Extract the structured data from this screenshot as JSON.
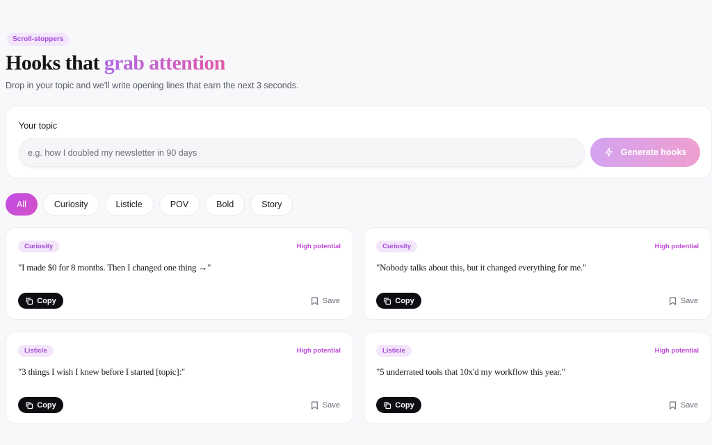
{
  "header": {
    "eyebrow": "Scroll-stoppers",
    "title_plain": "Hooks that",
    "title_accent": "grab attention",
    "subtitle": "Drop in your topic and we'll write opening lines that earn the next 3 seconds."
  },
  "topic": {
    "label": "Your topic",
    "placeholder": "e.g. how I doubled my newsletter in 90 days",
    "value": "",
    "generate_label": "Generate hooks",
    "generate_icon": "bolt-icon"
  },
  "filters": [
    {
      "label": "All",
      "active": true
    },
    {
      "label": "Curiosity",
      "active": false
    },
    {
      "label": "Listicle",
      "active": false
    },
    {
      "label": "POV",
      "active": false
    },
    {
      "label": "Bold",
      "active": false
    },
    {
      "label": "Story",
      "active": false
    }
  ],
  "hooks": [
    {
      "tag": "Curiosity",
      "potential": "High potential",
      "text": "\"I made $0 for 8 months. Then I changed one thing →\"",
      "copy_label": "Copy",
      "save_label": "Save"
    },
    {
      "tag": "Curiosity",
      "potential": "High potential",
      "text": "\"Nobody talks about this, but it changed everything for me.\"",
      "copy_label": "Copy",
      "save_label": "Save"
    },
    {
      "tag": "Listicle",
      "potential": "High potential",
      "text": "\"3 things I wish I knew before I started [topic]:\"",
      "copy_label": "Copy",
      "save_label": "Save"
    },
    {
      "tag": "Listicle",
      "potential": "High potential",
      "text": "\"5 underrated tools that 10x'd my workflow this year.\"",
      "copy_label": "Copy",
      "save_label": "Save"
    }
  ],
  "colors": {
    "accent_purple": "#c04ee6",
    "accent_pink": "#e05aa8",
    "tag_bg": "#f3e6fb",
    "copy_bg": "#0d0d12"
  }
}
